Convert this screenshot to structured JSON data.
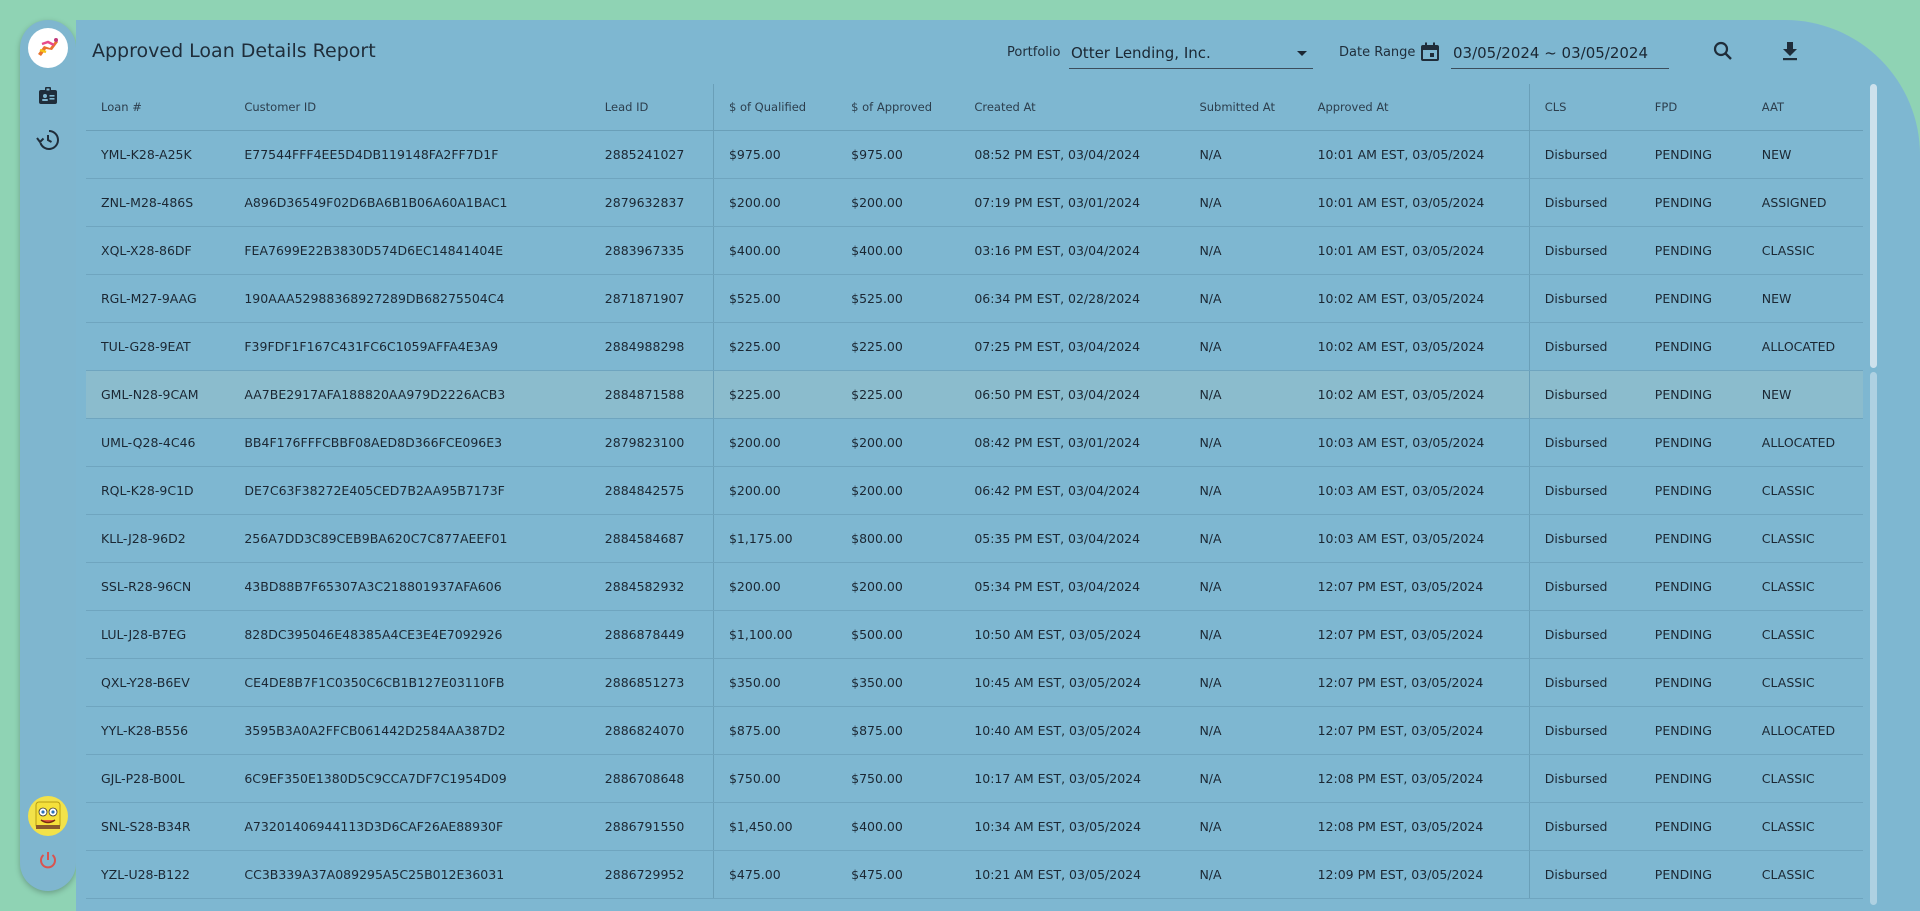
{
  "header": {
    "title": "Approved Loan Details Report",
    "portfolio_label": "Portfolio",
    "portfolio_value": "Otter Lending, Inc.",
    "date_range_label": "Date Range",
    "date_range_value": "03/05/2024 ~ 03/05/2024"
  },
  "sidebar": {
    "items": [
      {
        "icon": "id-badge-icon"
      },
      {
        "icon": "history-icon"
      }
    ]
  },
  "table": {
    "columns": [
      "Loan #",
      "Customer ID",
      "Lead ID",
      "$ of Qualified",
      "$ of Approved",
      "Created At",
      "Submitted At",
      "Approved At",
      "CLS",
      "FPD",
      "AAT"
    ],
    "rows": [
      [
        "YML-K28-A25K",
        "E77544FFF4EE5D4DB119148FA2FF7D1F",
        "2885241027",
        "$975.00",
        "$975.00",
        "08:52 PM EST, 03/04/2024",
        "N/A",
        "10:01 AM EST, 03/05/2024",
        "Disbursed",
        "PENDING",
        "NEW"
      ],
      [
        "ZNL-M28-486S",
        "A896D36549F02D6BA6B1B06A60A1BAC1",
        "2879632837",
        "$200.00",
        "$200.00",
        "07:19 PM EST, 03/01/2024",
        "N/A",
        "10:01 AM EST, 03/05/2024",
        "Disbursed",
        "PENDING",
        "ASSIGNED"
      ],
      [
        "XQL-X28-86DF",
        "FEA7699E22B3830D574D6EC14841404E",
        "2883967335",
        "$400.00",
        "$400.00",
        "03:16 PM EST, 03/04/2024",
        "N/A",
        "10:01 AM EST, 03/05/2024",
        "Disbursed",
        "PENDING",
        "CLASSIC"
      ],
      [
        "RGL-M27-9AAG",
        "190AAA52988368927289DB68275504C4",
        "2871871907",
        "$525.00",
        "$525.00",
        "06:34 PM EST, 02/28/2024",
        "N/A",
        "10:02 AM EST, 03/05/2024",
        "Disbursed",
        "PENDING",
        "NEW"
      ],
      [
        "TUL-G28-9EAT",
        "F39FDF1F167C431FC6C1059AFFA4E3A9",
        "2884988298",
        "$225.00",
        "$225.00",
        "07:25 PM EST, 03/04/2024",
        "N/A",
        "10:02 AM EST, 03/05/2024",
        "Disbursed",
        "PENDING",
        "ALLOCATED"
      ],
      [
        "GML-N28-9CAM",
        "AA7BE2917AFA188820AA979D2226ACB3",
        "2884871588",
        "$225.00",
        "$225.00",
        "06:50 PM EST, 03/04/2024",
        "N/A",
        "10:02 AM EST, 03/05/2024",
        "Disbursed",
        "PENDING",
        "NEW"
      ],
      [
        "UML-Q28-4C46",
        "BB4F176FFFCBBF08AED8D366FCE096E3",
        "2879823100",
        "$200.00",
        "$200.00",
        "08:42 PM EST, 03/01/2024",
        "N/A",
        "10:03 AM EST, 03/05/2024",
        "Disbursed",
        "PENDING",
        "ALLOCATED"
      ],
      [
        "RQL-K28-9C1D",
        "DE7C63F38272E405CED7B2AA95B7173F",
        "2884842575",
        "$200.00",
        "$200.00",
        "06:42 PM EST, 03/04/2024",
        "N/A",
        "10:03 AM EST, 03/05/2024",
        "Disbursed",
        "PENDING",
        "CLASSIC"
      ],
      [
        "KLL-J28-96D2",
        "256A7DD3C89CEB9BA620C7C877AEEF01",
        "2884584687",
        "$1,175.00",
        "$800.00",
        "05:35 PM EST, 03/04/2024",
        "N/A",
        "10:03 AM EST, 03/05/2024",
        "Disbursed",
        "PENDING",
        "CLASSIC"
      ],
      [
        "SSL-R28-96CN",
        "43BD88B7F65307A3C218801937AFA606",
        "2884582932",
        "$200.00",
        "$200.00",
        "05:34 PM EST, 03/04/2024",
        "N/A",
        "12:07 PM EST, 03/05/2024",
        "Disbursed",
        "PENDING",
        "CLASSIC"
      ],
      [
        "LUL-J28-B7EG",
        "828DC395046E48385A4CE3E4E7092926",
        "2886878449",
        "$1,100.00",
        "$500.00",
        "10:50 AM EST, 03/05/2024",
        "N/A",
        "12:07 PM EST, 03/05/2024",
        "Disbursed",
        "PENDING",
        "CLASSIC"
      ],
      [
        "QXL-Y28-B6EV",
        "CE4DE8B7F1C0350C6CB1B127E03110FB",
        "2886851273",
        "$350.00",
        "$350.00",
        "10:45 AM EST, 03/05/2024",
        "N/A",
        "12:07 PM EST, 03/05/2024",
        "Disbursed",
        "PENDING",
        "CLASSIC"
      ],
      [
        "YYL-K28-B556",
        "3595B3A0A2FFCB061442D2584AA387D2",
        "2886824070",
        "$875.00",
        "$875.00",
        "10:40 AM EST, 03/05/2024",
        "N/A",
        "12:07 PM EST, 03/05/2024",
        "Disbursed",
        "PENDING",
        "ALLOCATED"
      ],
      [
        "GJL-P28-B00L",
        "6C9EF350E1380D5C9CCA7DF7C1954D09",
        "2886708648",
        "$750.00",
        "$750.00",
        "10:17 AM EST, 03/05/2024",
        "N/A",
        "12:08 PM EST, 03/05/2024",
        "Disbursed",
        "PENDING",
        "CLASSIC"
      ],
      [
        "SNL-S28-B34R",
        "A73201406944113D3D6CAF26AE88930F",
        "2886791550",
        "$1,450.00",
        "$400.00",
        "10:34 AM EST, 03/05/2024",
        "N/A",
        "12:08 PM EST, 03/05/2024",
        "Disbursed",
        "PENDING",
        "CLASSIC"
      ],
      [
        "YZL-U28-B122",
        "CC3B339A37A089295A5C25B012E36031",
        "2886729952",
        "$475.00",
        "$475.00",
        "10:21 AM EST, 03/05/2024",
        "N/A",
        "12:09 PM EST, 03/05/2024",
        "Disbursed",
        "PENDING",
        "CLASSIC"
      ]
    ]
  }
}
